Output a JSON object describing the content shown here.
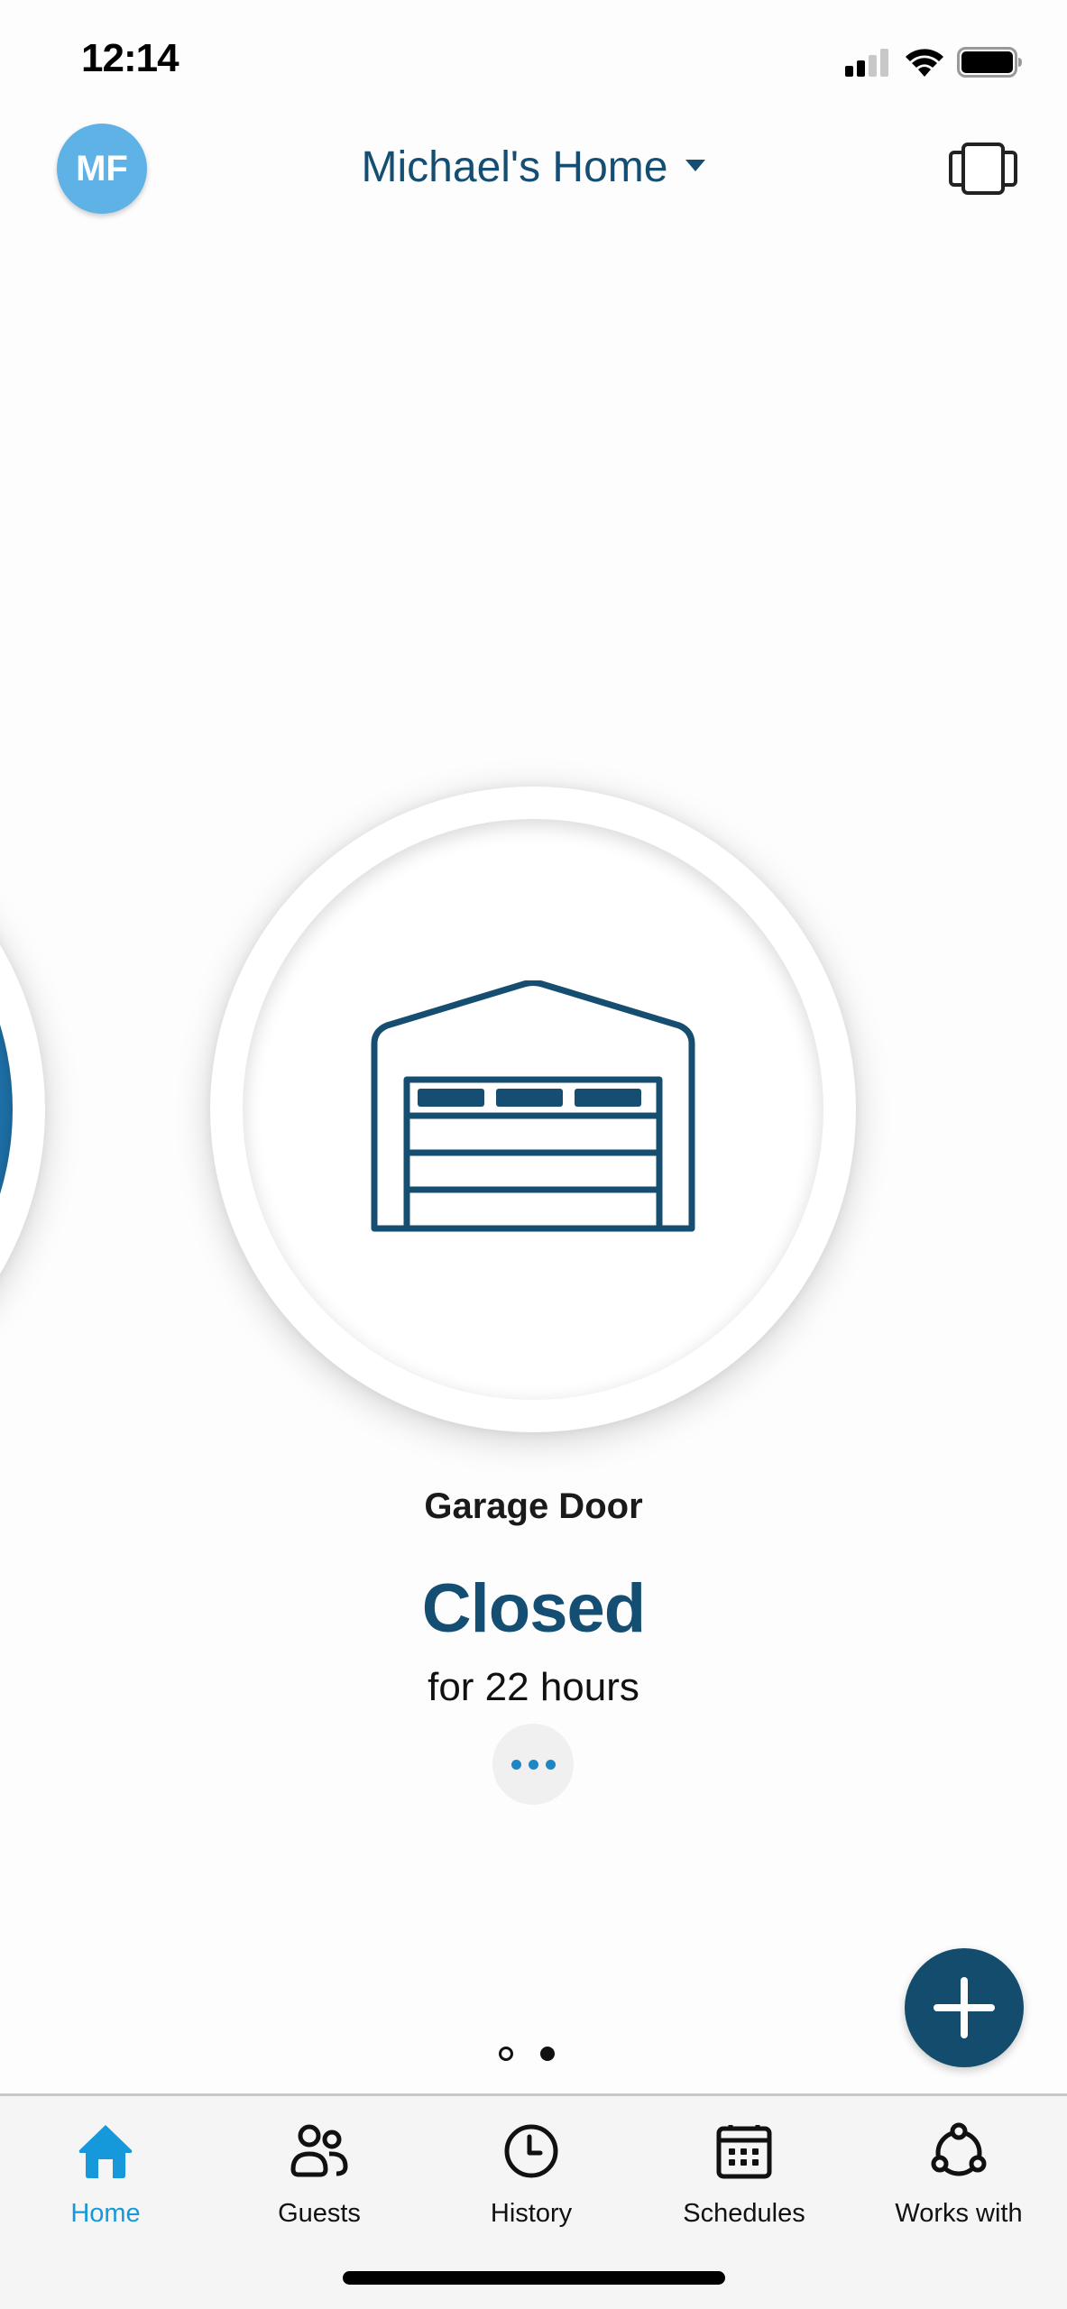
{
  "status_bar": {
    "time": "12:14",
    "icons": [
      "cellular-signal-icon",
      "wifi-icon",
      "battery-icon"
    ]
  },
  "header": {
    "avatar_initials": "MF",
    "home_name": "Michael's Home",
    "home_dropdown_icon": "caret-down-icon",
    "devices_view_icon": "carousel-view-icon"
  },
  "carousel": {
    "current_device": {
      "name": "Garage Door",
      "status": "Closed",
      "duration": "for 22 hours",
      "icon": "garage-door-icon",
      "more_icon": "ellipsis-icon"
    },
    "page_count": 2,
    "current_page": 2
  },
  "fab": {
    "icon": "plus-icon"
  },
  "tab_bar": {
    "items": [
      {
        "label": "Home",
        "icon": "home-icon",
        "active": true
      },
      {
        "label": "Guests",
        "icon": "guests-icon",
        "active": false
      },
      {
        "label": "History",
        "icon": "clock-icon",
        "active": false
      },
      {
        "label": "Schedules",
        "icon": "calendar-icon",
        "active": false
      },
      {
        "label": "Works with",
        "icon": "integrations-icon",
        "active": false
      }
    ]
  },
  "colors": {
    "brand_dark": "#144e73",
    "accent": "#1599da",
    "avatar_bg": "#5fb2e6",
    "fab_bg": "#134c6d"
  }
}
